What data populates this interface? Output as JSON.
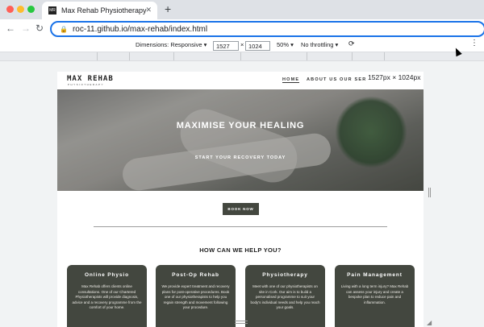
{
  "browser": {
    "tab_title": "Max Rehab Physiotherapy",
    "tab_favicon_text": "MR",
    "close_icon": "close-icon",
    "new_tab_symbol": "+",
    "url": "roc-11.github.io/max-rehab/index.html",
    "back_symbol": "←",
    "forward_symbol": "→",
    "reload_symbol": "↻",
    "menu_symbol": "⋮"
  },
  "devtools": {
    "dimensions_label": "Dimensions: Responsive ▾",
    "width": "1527",
    "times": "×",
    "height": "1024",
    "zoom": "50% ▾",
    "throttling": "No throttling ▾",
    "rotate_icon": "rotate-icon",
    "size_badge": "1527px × 1024px"
  },
  "site": {
    "logo": "MAX REHAB",
    "logo_sub": "PHYSIOTHERAPY",
    "nav": [
      "HOME",
      "ABOUT US",
      "OUR SERVI"
    ],
    "hero_title": "MAXIMISE YOUR HEALING",
    "hero_subtitle": "START YOUR RECOVERY TODAY",
    "book_button": "BOOK NOW",
    "help_heading": "HOW CAN WE HELP YOU?",
    "cards": [
      {
        "title": "Online Physio",
        "text": "Max Rehab offers clients online consultations. One of our Chartered Physiotherapists will provide diagnosis, advice and a recovery programme from the comfort of your home."
      },
      {
        "title": "Post-Op Rehab",
        "text": "We provide expert treatment and recovery plans for post-operative procedures. Book one of our physiotherapists to help you regain strength and movement following your procedure."
      },
      {
        "title": "Physiotherapy",
        "text": "Meet with one of our physiotherapists on site in Cork. Our aim is to build a personalised programme to suit your body's individual needs and help you reach your goals."
      },
      {
        "title": "Pain Management",
        "text": "Living with a long term injury? Max Rehab can assess your injury and create a bespoke plan to reduce pain and inflammation."
      }
    ]
  },
  "colors": {
    "accent": "#1a73e8",
    "card_bg": "#43473f",
    "traffic_red": "#ff5f57",
    "traffic_yellow": "#febc2e",
    "traffic_green": "#28c840"
  }
}
